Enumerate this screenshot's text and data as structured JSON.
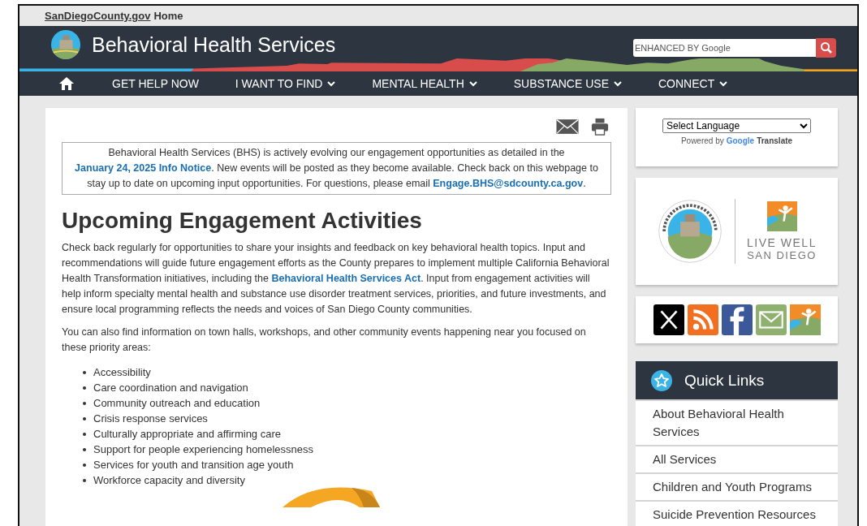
{
  "top_bar": {
    "link": "SanDiegoCounty.gov",
    "text": "Home"
  },
  "header": {
    "title": "Behavioral Health Services",
    "search": {
      "placeholder": "ENHANCED BY Google"
    }
  },
  "nav": [
    {
      "kind": "home"
    },
    {
      "kind": "link",
      "label": "GET HELP NOW",
      "has_dropdown": false
    },
    {
      "kind": "link",
      "label": "I WANT TO FIND",
      "has_dropdown": true
    },
    {
      "kind": "link",
      "label": "MENTAL HEALTH",
      "has_dropdown": true
    },
    {
      "kind": "link",
      "label": "SUBSTANCE USE",
      "has_dropdown": true
    },
    {
      "kind": "link",
      "label": "CONNECT",
      "has_dropdown": true
    }
  ],
  "notice": [
    {
      "text": "Behavioral Health Services (BHS) is actively evolving our engagement opportunities as detailed in the ",
      "link": false
    },
    {
      "text": "January 24, 2025 Info Notice",
      "link": true
    },
    {
      "text": ". New events will be posted as they become available. Check back on this webpage to stay up to date on upcoming input opportunities. For questions, please email ",
      "link": false
    },
    {
      "text": "Engage.BHS@sdcounty.ca.gov",
      "link": true
    },
    {
      "text": ".",
      "link": false
    }
  ],
  "heading": "Upcoming Engagement Activities",
  "intro": [
    {
      "text": "Check back regularly for opportunities to share your insights and feedback on key behavioral health topics. Input and recommendations will guide future engagement efforts as the County prepares to implement multiple California Behavioral Health Transformation initiatives, including the ",
      "link": false
    },
    {
      "text": "Behavioral Health Services Act",
      "link": true
    },
    {
      "text": ". Input from engagement activities will help inform specialty mental health and substance use disorder treatment services, priorities, and future investments, and ensure local programming reflects the needs and voices of San Diego County communities.",
      "link": false
    }
  ],
  "paragraph": "You can also find information on town halls, workshops, and other community events happening near you focused on these priority areas:",
  "priority_areas": [
    "Accessibility",
    "Care coordination and navigation",
    "Community outreach and education",
    "Crisis response services",
    "Culturally appropriate and affirming care",
    "Support for people experiencing homelessness",
    "Services for youth and transition age youth",
    "Workforce capacity and diversity"
  ],
  "sidebar": {
    "language_select": {
      "value": "Select Language",
      "powered_by": "Powered by",
      "google": "Google",
      "translate": "Translate"
    },
    "logo_text": [
      "LIVE WELL",
      "SAN DIEGO"
    ],
    "social": [
      {
        "kind": "x"
      },
      {
        "kind": "rss"
      },
      {
        "kind": "facebook"
      },
      {
        "kind": "email"
      },
      {
        "kind": "livewell"
      }
    ],
    "quick_links": {
      "title": "Quick Links",
      "items": [
        "About Behavioral Health Services",
        "All Services",
        "Children and Youth Programs",
        "Suicide Prevention Resources"
      ]
    }
  }
}
